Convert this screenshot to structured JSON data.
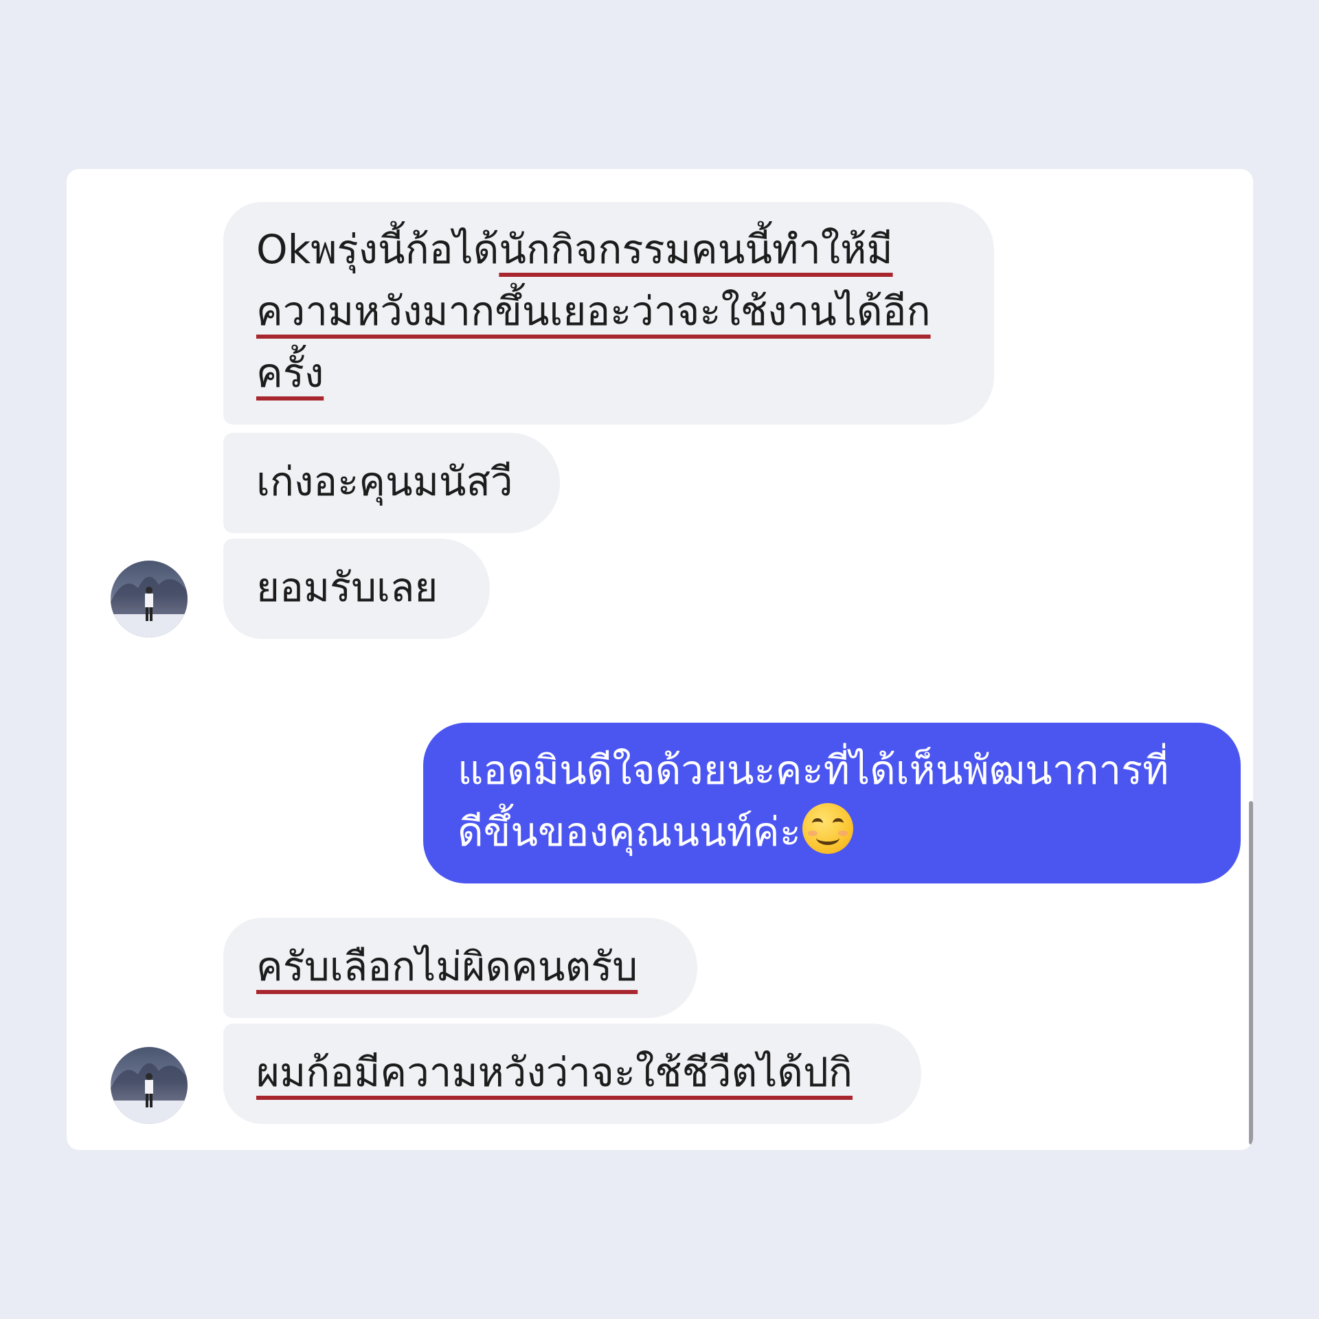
{
  "messages": [
    {
      "side": "incoming",
      "lines": [
        {
          "plain": "Okพรุ่งนี้ก้อได้",
          "underlined": "นักกิจกรรมคนนี้ทำให้มี"
        },
        {
          "plain": "",
          "underlined": "ความหวังมากขึ้นเยอะว่าจะใช้งานได้อีก"
        },
        {
          "plain": "",
          "underlined": "ครั้ง"
        }
      ]
    },
    {
      "side": "incoming",
      "text": "เก่งอะคุนมนัสวี"
    },
    {
      "side": "incoming",
      "text": "ยอมรับเลย"
    },
    {
      "side": "outgoing",
      "line1": "แอดมินดีใจด้วยนะคะที่ได้เห็นพัฒนาการที่",
      "line2": "ดีขึ้นของคุณนนท์ค่ะ",
      "emoji": "smiling-face-emoji"
    },
    {
      "side": "incoming",
      "text": "ครับเลือกไม่ผิดคนตรับ",
      "underlined": true
    },
    {
      "side": "incoming",
      "text": "ผมก้อมีความหวังว่าจะใช้ชีวืตได้ปกิ",
      "underlined": true
    }
  ],
  "colors": {
    "page_background": "#e9ecf4",
    "incoming_bubble": "#f0f1f5",
    "outgoing_bubble": "#4b55f0",
    "underline_highlight": "#a8262d"
  }
}
